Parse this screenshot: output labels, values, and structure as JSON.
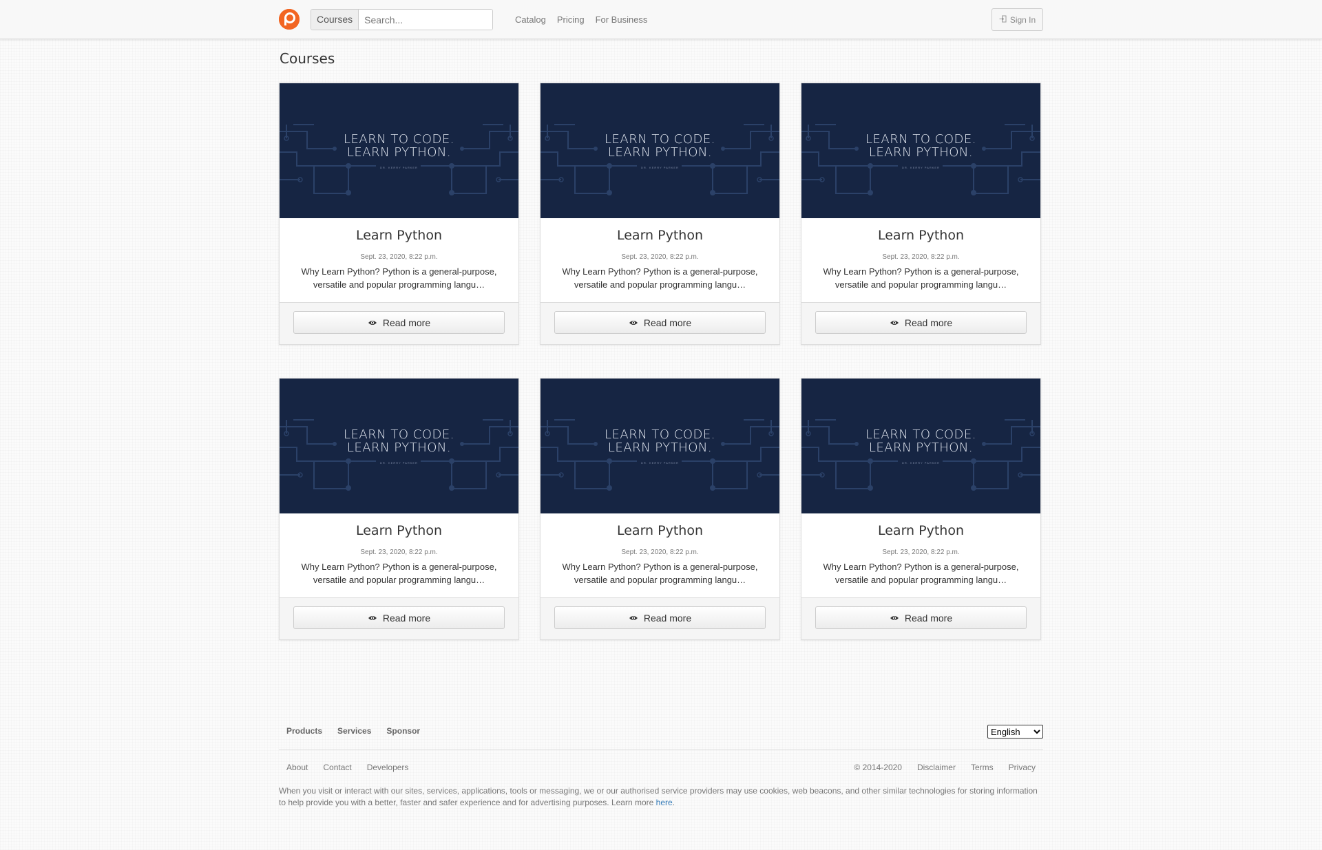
{
  "navbar": {
    "search_addon": "Courses",
    "search_placeholder": "Search...",
    "links": [
      "Catalog",
      "Pricing",
      "For Business"
    ],
    "signin_label": "Sign In"
  },
  "page": {
    "title": "Courses"
  },
  "colors": {
    "brand": "#f26522",
    "banner_bg": "#162543",
    "link": "#337ab7"
  },
  "courses": [
    {
      "banner_line1": "LEARN TO CODE.",
      "banner_line2": "LEARN PYTHON.",
      "banner_author": "DR. KERRY PARKER",
      "title": "Learn Python",
      "date": "Sept. 23, 2020, 8:22 p.m.",
      "description": "Why Learn Python? Python is a general-purpose, versatile and popular programming langu…",
      "button_label": "Read more"
    },
    {
      "banner_line1": "LEARN TO CODE.",
      "banner_line2": "LEARN PYTHON.",
      "banner_author": "DR. KERRY PARKER",
      "title": "Learn Python",
      "date": "Sept. 23, 2020, 8:22 p.m.",
      "description": "Why Learn Python? Python is a general-purpose, versatile and popular programming langu…",
      "button_label": "Read more"
    },
    {
      "banner_line1": "LEARN TO CODE.",
      "banner_line2": "LEARN PYTHON.",
      "banner_author": "DR. KERRY PARKER",
      "title": "Learn Python",
      "date": "Sept. 23, 2020, 8:22 p.m.",
      "description": "Why Learn Python? Python is a general-purpose, versatile and popular programming langu…",
      "button_label": "Read more"
    },
    {
      "banner_line1": "LEARN TO CODE.",
      "banner_line2": "LEARN PYTHON.",
      "banner_author": "DR. KERRY PARKER",
      "title": "Learn Python",
      "date": "Sept. 23, 2020, 8:22 p.m.",
      "description": "Why Learn Python? Python is a general-purpose, versatile and popular programming langu…",
      "button_label": "Read more"
    },
    {
      "banner_line1": "LEARN TO CODE.",
      "banner_line2": "LEARN PYTHON.",
      "banner_author": "DR. KERRY PARKER",
      "title": "Learn Python",
      "date": "Sept. 23, 2020, 8:22 p.m.",
      "description": "Why Learn Python? Python is a general-purpose, versatile and popular programming langu…",
      "button_label": "Read more"
    },
    {
      "banner_line1": "LEARN TO CODE.",
      "banner_line2": "LEARN PYTHON.",
      "banner_author": "DR. KERRY PARKER",
      "title": "Learn Python",
      "date": "Sept. 23, 2020, 8:22 p.m.",
      "description": "Why Learn Python? Python is a general-purpose, versatile and popular programming langu…",
      "button_label": "Read more"
    }
  ],
  "footer": {
    "top_links": [
      "Products",
      "Services",
      "Sponsor"
    ],
    "language": "English",
    "left_links": [
      "About",
      "Contact",
      "Developers"
    ],
    "right_links": [
      "© 2014-2020",
      "Disclaimer",
      "Terms",
      "Privacy"
    ],
    "cookie_text": "When you visit or interact with our sites, services, applications, tools or messaging, we or our authorised service providers may use cookies, web beacons, and other similar technologies for storing information to help provide you with a better, faster and safer experience and for advertising purposes. Learn more",
    "cookie_link": "here",
    "cookie_end": "."
  }
}
